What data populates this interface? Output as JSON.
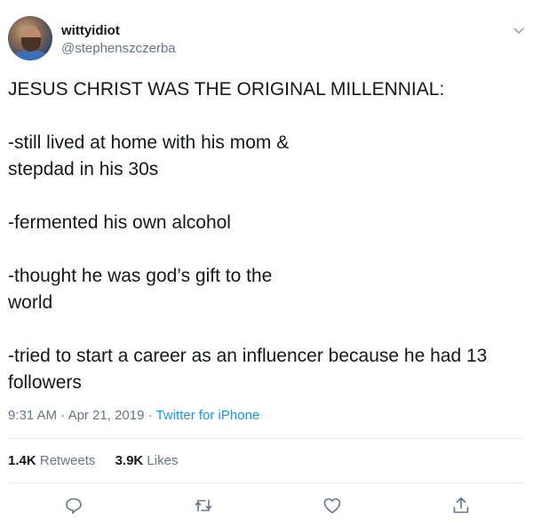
{
  "user": {
    "display_name": "wittyidiot",
    "handle": "@stephenszczerba"
  },
  "tweet": {
    "lines": [
      "JESUS CHRIST WAS THE ORIGINAL MILLENNIAL:",
      "-still lived at home with his mom &",
      "stepdad in his 30s",
      "-fermented his own alcohol",
      "-thought he was god’s gift to the",
      "world",
      "-tried to start a career as an influencer because he had 13",
      "followers"
    ]
  },
  "meta": {
    "time": "9:31 AM",
    "separator": " · ",
    "date": "Apr 21, 2019",
    "source": "Twitter for iPhone"
  },
  "stats": {
    "retweets_count": "1.4K",
    "retweets_label": "Retweets",
    "likes_count": "3.9K",
    "likes_label": "Likes"
  },
  "icons": {
    "options": "chevron-down-icon",
    "reply": "reply-icon",
    "retweet": "retweet-icon",
    "like": "heart-icon",
    "share": "share-icon"
  },
  "colors": {
    "text": "#14171a",
    "secondary": "#657786",
    "link": "#1b95e0",
    "divider": "#e6ecf0"
  }
}
